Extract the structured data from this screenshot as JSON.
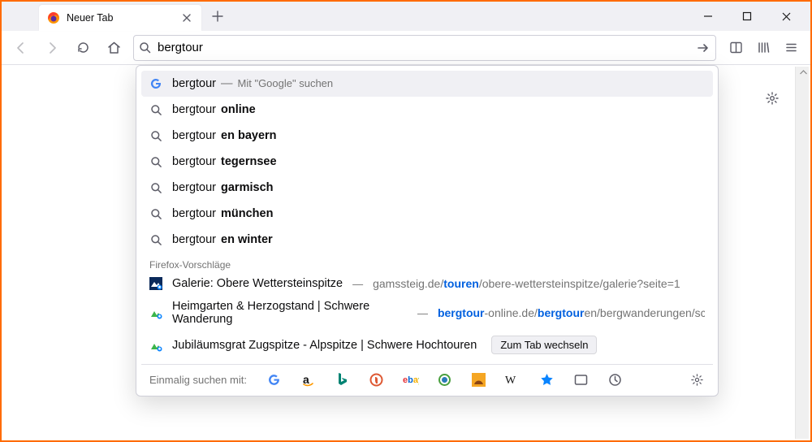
{
  "tab": {
    "title": "Neuer Tab"
  },
  "urlbar": {
    "query": "bergtour"
  },
  "suggestions": {
    "primary": {
      "term": "bergtour",
      "engine_hint": "Mit \"Google\" suchen",
      "dash": "—"
    },
    "items": [
      {
        "prefix": "bergtour ",
        "bold": "online"
      },
      {
        "prefix": "bergtour",
        "bold": "en bayern"
      },
      {
        "prefix": "bergtour ",
        "bold": "tegernsee"
      },
      {
        "prefix": "bergtour ",
        "bold": "garmisch"
      },
      {
        "prefix": "bergtour ",
        "bold": "münchen"
      },
      {
        "prefix": "bergtour",
        "bold": "en winter"
      }
    ]
  },
  "firefox_suggest": {
    "label": "Firefox-Vorschläge",
    "rows": [
      {
        "icon": "gamssteig",
        "title": "Galerie: Obere Wettersteinspitze",
        "dash": "—",
        "url_parts": [
          "gamssteig.de/",
          "touren",
          "/obere-wettersteinspitze/galerie?seite=1"
        ]
      },
      {
        "icon": "bergtour",
        "title": "Heimgarten & Herzogstand | Schwere Wanderung",
        "dash": "—",
        "url_parts": [
          "",
          "bergtour",
          "-online.de/",
          "bergtour",
          "en/bergwanderungen/schwer/"
        ]
      },
      {
        "icon": "bergtour",
        "title": "Jubiläumsgrat Zugspitze - Alpspitze | Schwere Hochtouren",
        "switch": "Zum Tab wechseln"
      }
    ]
  },
  "oneoff": {
    "label": "Einmalig suchen mit:",
    "engines": [
      "google",
      "amazon",
      "bing",
      "duckduckgo",
      "ebay",
      "ecosia",
      "leo",
      "wikipedia",
      "bookmarks",
      "tabs",
      "history"
    ]
  }
}
